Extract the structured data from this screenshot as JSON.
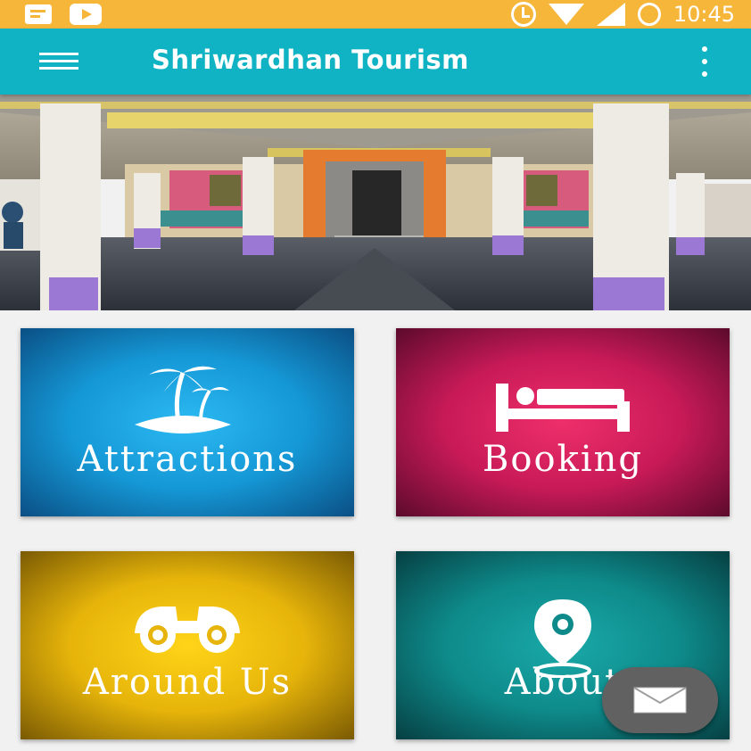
{
  "status_bar": {
    "time": "10:45",
    "icons": [
      "notification-icon",
      "youtube-icon",
      "alarm-icon",
      "wifi-icon",
      "signal-icon",
      "battery-icon"
    ],
    "background_color": "#f6b63a"
  },
  "app_bar": {
    "title": "Shriwardhan Tourism",
    "menu_icon": "hamburger-menu-icon",
    "overflow_icon": "more-vert-icon",
    "background_color": "#0fb3c3"
  },
  "banner": {
    "image": "temple-interior-photo"
  },
  "tiles": [
    {
      "label": "Attractions",
      "icon": "palm-island-icon",
      "color": "#1598d6"
    },
    {
      "label": "Booking",
      "icon": "bed-icon",
      "color": "#c81a57"
    },
    {
      "label": "Around Us",
      "icon": "binoculars-icon",
      "color": "#e6b40a"
    },
    {
      "label": "About",
      "icon": "location-pin-icon",
      "color": "#0e8a8a"
    }
  ],
  "fab": {
    "icon": "envelope-icon",
    "color": "#616161"
  }
}
